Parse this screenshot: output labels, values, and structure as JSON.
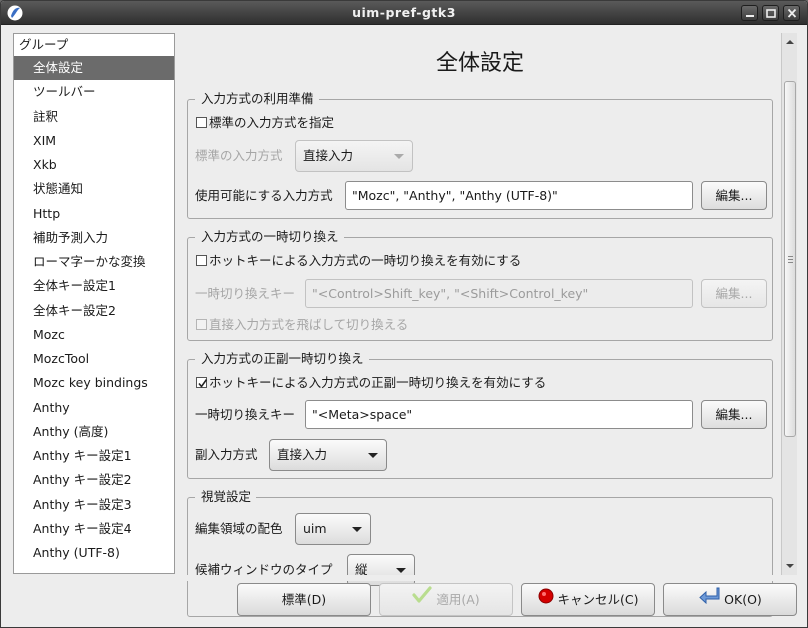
{
  "window": {
    "title": "uim-pref-gtk3"
  },
  "sidebar": {
    "header": "グループ",
    "items": [
      "全体設定",
      "ツールバー",
      "註釈",
      "XIM",
      "Xkb",
      "状態通知",
      "Http",
      "補助予測入力",
      "ローマ字ーかな変換",
      "全体キー設定1",
      "全体キー設定2",
      "Mozc",
      "MozcTool",
      "Mozc key bindings",
      "Anthy",
      "Anthy (高度)",
      "Anthy キー設定1",
      "Anthy キー設定2",
      "Anthy キー設定3",
      "Anthy キー設定4",
      "Anthy (UTF-8)"
    ],
    "selected": "全体設定"
  },
  "main": {
    "title": "全体設定",
    "section1": {
      "label": "入力方式の利用準備",
      "specify_default_check": "標準の入力方式を指定",
      "specify_default_checked": false,
      "default_im_label": "標準の入力方式",
      "default_im_value": "直接入力",
      "enabled_im_label": "使用可能にする入力方式",
      "enabled_im_value": "\"Mozc\", \"Anthy\", \"Anthy (UTF-8)\"",
      "edit_button": "編集..."
    },
    "section2": {
      "label": "入力方式の一時切り換え",
      "enable_toggle_check": "ホットキーによる入力方式の一時切り換えを有効にする",
      "enable_toggle_checked": false,
      "toggle_key_label": "一時切り換えキー",
      "toggle_key_value": "\"<Control>Shift_key\", \"<Shift>Control_key\"",
      "edit_button": "編集...",
      "skip_direct_check": "直接入力方式を飛ばして切り換える",
      "skip_direct_checked": false
    },
    "section3": {
      "label": "入力方式の正副一時切り換え",
      "enable_toggle_check": "ホットキーによる入力方式の正副一時切り換えを有効にする",
      "enable_toggle_checked": true,
      "toggle_key_label": "一時切り換えキー",
      "toggle_key_value": "\"<Meta>space\"",
      "edit_button": "編集...",
      "secondary_im_label": "副入力方式",
      "secondary_im_value": "直接入力"
    },
    "section4": {
      "label": "視覚設定",
      "preedit_color_label": "編集領域の配色",
      "preedit_color_value": "uim",
      "candidate_window_label": "候補ウィンドウのタイプ",
      "candidate_window_value": "縦"
    }
  },
  "footer": {
    "default_button": "標準(D)",
    "apply_button": "適用(A)",
    "cancel_button": "キャンセル(C)",
    "ok_button": "OK(O)"
  },
  "colors": {
    "selected_row_bg": "#6b6b6b",
    "titlebar_bg": "#3a3a3a",
    "window_bg": "#ededed",
    "cancel_icon": "#d40000",
    "apply_icon": "#8fd14f",
    "ok_icon": "#3a74c4"
  },
  "icons": {
    "app": "uim-logo-icon",
    "minimize": "minimize-icon",
    "maximize": "maximize-icon",
    "close": "close-icon",
    "apply": "checkmark-icon",
    "cancel": "stop-circle-icon",
    "ok": "return-arrow-icon"
  }
}
